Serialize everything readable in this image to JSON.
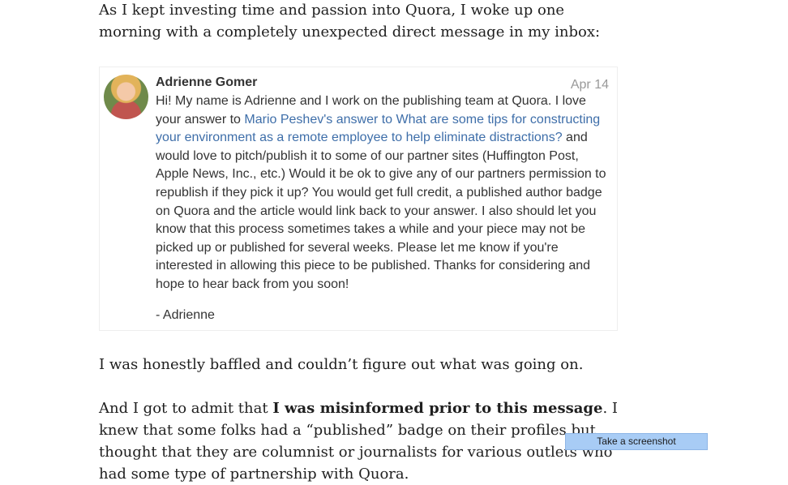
{
  "article": {
    "intro": "As I kept investing time and passion into Quora, I woke up one morning with a completely unexpected direct message in my inbox:",
    "reaction": "I was honestly baffled and couldn’t figure out what was going on.",
    "admit_prefix": "And I got to admit that ",
    "admit_bold": "I was misinformed prior to this message",
    "admit_suffix": ". I knew that some folks had a “published” badge on their profiles but thought that they are columnist or journalists for various outlets who had some type of partnership with Quora."
  },
  "message": {
    "sender": "Adrienne Gomer",
    "date": "Apr 14",
    "body_start": "Hi! My name is Adrienne and I work on the publishing team at Quora. I love your answer to ",
    "link_text": "Mario Peshev's answer to What are some tips for constructing your environment as a remote employee to help eliminate distractions?",
    "body_end": " and would love to pitch/publish it to some of our partner sites (Huffington Post, Apple News, Inc., etc.) Would it be ok to give any of our partners permission to republish if they pick it up? You would get full credit, a published author badge on Quora and the article would link back to your answer. I also should let you know that this process sometimes takes a while and your piece may not be picked up or published for several weeks. Please let me know if you're interested in allowing this piece to be published. Thanks for considering and hope to hear back from you soon!",
    "signature": "- Adrienne"
  },
  "overlay": {
    "screenshot_tip": "Take a screenshot"
  },
  "colors": {
    "link": "#3e6ea9",
    "date": "#999999",
    "tip_bg": "#a8ccf5"
  },
  "icons": {
    "avatar": "user-avatar-photo"
  }
}
